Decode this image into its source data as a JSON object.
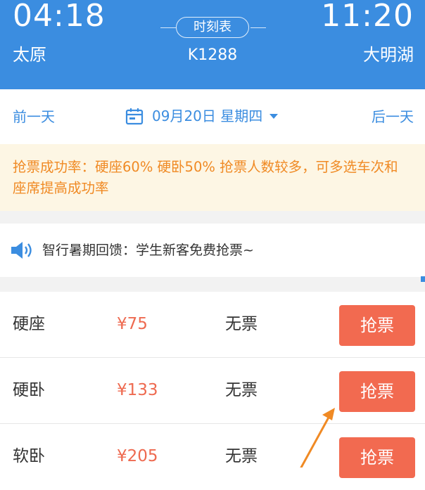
{
  "header": {
    "departure_time": "04:18",
    "arrival_time": "11:20",
    "departure_station": "太原",
    "arrival_station": "大明湖",
    "schedule_label": "时刻表",
    "train_number": "K1288",
    "background_color": "#3b8de0"
  },
  "date_bar": {
    "prev_label": "前一天",
    "next_label": "后一天",
    "date_text": "09月20日 星期四",
    "calendar_icon": "calendar-icon",
    "dropdown_icon": "caret-down-icon"
  },
  "notice": {
    "text": "抢票成功率：硬座60% 硬卧50% 抢票人数较多，可多选车次和座席提高成功率",
    "color": "#f08a24"
  },
  "announcement": {
    "icon": "speaker-icon",
    "text": "智行暑期回馈：学生新客免费抢票~"
  },
  "seats": [
    {
      "name": "硬座",
      "price": "¥75",
      "status": "无票",
      "button": "抢票"
    },
    {
      "name": "硬卧",
      "price": "¥133",
      "status": "无票",
      "button": "抢票"
    },
    {
      "name": "软卧",
      "price": "¥205",
      "status": "无票",
      "button": "抢票"
    }
  ],
  "colors": {
    "accent": "#3b8de0",
    "button": "#f26a50",
    "price": "#ee6a50",
    "annotation_arrow": "#f08a24"
  }
}
